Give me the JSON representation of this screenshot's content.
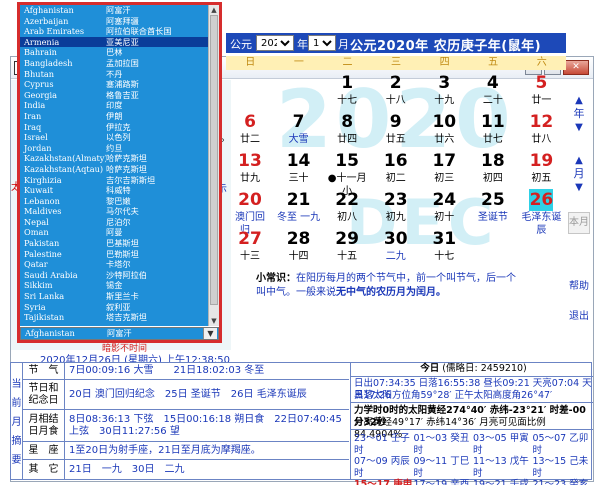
{
  "window": {
    "app_icon": "口",
    "buttons": [
      "▭",
      "▢",
      "✕"
    ]
  },
  "header": {
    "prefix": "公元",
    "year_value": "2020",
    "year_suffix": "年",
    "month_value": "12",
    "month_suffix": "月",
    "title": "公元2020年 农历庚子年(鼠年)"
  },
  "watermark": {
    "year": "2020",
    "month": "DEC"
  },
  "weekdays": [
    "日",
    "一",
    "二",
    "三",
    "四",
    "五",
    "六"
  ],
  "days": [
    {
      "d": "1",
      "l": "十七",
      "col": 2,
      "row": 0,
      "dc": "#000",
      "lc": "#000"
    },
    {
      "d": "2",
      "l": "十八",
      "col": 3,
      "row": 0,
      "dc": "#000",
      "lc": "#000"
    },
    {
      "d": "3",
      "l": "十九",
      "col": 4,
      "row": 0,
      "dc": "#000",
      "lc": "#000"
    },
    {
      "d": "4",
      "l": "二十",
      "col": 5,
      "row": 0,
      "dc": "#000",
      "lc": "#000"
    },
    {
      "d": "5",
      "l": "廿一",
      "col": 6,
      "row": 0,
      "dc": "#d42020",
      "lc": "#000"
    },
    {
      "d": "6",
      "l": "廿二",
      "col": 0,
      "row": 1,
      "dc": "#d42020",
      "lc": "#000"
    },
    {
      "d": "7",
      "l": "大雪",
      "col": 1,
      "row": 1,
      "dc": "#000",
      "lc": "#1a37b8"
    },
    {
      "d": "8",
      "l": "廿四",
      "col": 2,
      "row": 1,
      "dc": "#000",
      "lc": "#000"
    },
    {
      "d": "9",
      "l": "廿五",
      "col": 3,
      "row": 1,
      "dc": "#000",
      "lc": "#000"
    },
    {
      "d": "10",
      "l": "廿六",
      "col": 4,
      "row": 1,
      "dc": "#000",
      "lc": "#000"
    },
    {
      "d": "11",
      "l": "廿七",
      "col": 5,
      "row": 1,
      "dc": "#000",
      "lc": "#000"
    },
    {
      "d": "12",
      "l": "廿八",
      "col": 6,
      "row": 1,
      "dc": "#d42020",
      "lc": "#000"
    },
    {
      "d": "13",
      "l": "廿九",
      "col": 0,
      "row": 2,
      "dc": "#d42020",
      "lc": "#000"
    },
    {
      "d": "14",
      "l": "三十",
      "col": 1,
      "row": 2,
      "dc": "#000",
      "lc": "#000"
    },
    {
      "d": "15",
      "l": "●十一月小",
      "col": 2,
      "row": 2,
      "dc": "#000",
      "lc": "#000"
    },
    {
      "d": "16",
      "l": "初二",
      "col": 3,
      "row": 2,
      "dc": "#000",
      "lc": "#000"
    },
    {
      "d": "17",
      "l": "初三",
      "col": 4,
      "row": 2,
      "dc": "#000",
      "lc": "#000"
    },
    {
      "d": "18",
      "l": "初四",
      "col": 5,
      "row": 2,
      "dc": "#000",
      "lc": "#000"
    },
    {
      "d": "19",
      "l": "初五",
      "col": 6,
      "row": 2,
      "dc": "#d42020",
      "lc": "#000"
    },
    {
      "d": "20",
      "l": "澳门回归…",
      "col": 0,
      "row": 3,
      "dc": "#d42020",
      "lc": "#1a37b8"
    },
    {
      "d": "21",
      "l": "冬至 一九",
      "col": 1,
      "row": 3,
      "dc": "#000",
      "lc": "#1a37b8"
    },
    {
      "d": "22",
      "l": "初八",
      "col": 2,
      "row": 3,
      "dc": "#000",
      "lc": "#000"
    },
    {
      "d": "23",
      "l": "初九",
      "col": 3,
      "row": 3,
      "dc": "#000",
      "lc": "#000"
    },
    {
      "d": "24",
      "l": "初十",
      "col": 4,
      "row": 3,
      "dc": "#000",
      "lc": "#000"
    },
    {
      "d": "25",
      "l": "圣诞节",
      "col": 5,
      "row": 3,
      "dc": "#000",
      "lc": "#1a37b8"
    },
    {
      "d": "26",
      "l": "毛泽东诞辰",
      "col": 6,
      "row": 3,
      "dc": "#d42020",
      "lc": "#1a37b8",
      "today": true
    },
    {
      "d": "27",
      "l": "十三",
      "col": 0,
      "row": 4,
      "dc": "#d42020",
      "lc": "#000"
    },
    {
      "d": "28",
      "l": "十四",
      "col": 1,
      "row": 4,
      "dc": "#000",
      "lc": "#000"
    },
    {
      "d": "29",
      "l": "十五",
      "col": 2,
      "row": 4,
      "dc": "#000",
      "lc": "#000"
    },
    {
      "d": "30",
      "l": "二九",
      "col": 3,
      "row": 4,
      "dc": "#000",
      "lc": "#1a37b8"
    },
    {
      "d": "31",
      "l": "十七",
      "col": 4,
      "row": 4,
      "dc": "#000",
      "lc": "#000"
    }
  ],
  "side_buttons": {
    "year_up": "▲",
    "year_label": "年",
    "year_down": "▼",
    "month_up": "▲",
    "month_label": "月",
    "month_down": "▼",
    "this_month": "本月",
    "help": "帮助",
    "exit": "退出"
  },
  "tip": {
    "label": "小常识：",
    "text1": "在阳历每月的两个节气中，前一个叫节气，后一个",
    "text2a": "叫中气。一般来说",
    "text2b": "无中气的农历月为闰月。"
  },
  "left_pane": {
    "partial1": "时",
    "partial2": "25°",
    "partial3": "太",
    "partial4": "时示"
  },
  "bottom": {
    "partial_top": "暗影不时间",
    "datetime": "2020年12月26日 (星期六) 上午12:38:50",
    "vlabel": [
      "当",
      "前",
      "月",
      "摘",
      "要"
    ],
    "rows": [
      {
        "k": "节　气",
        "v": "7日00:09:16 大雪　　21日18:02:03 冬至"
      },
      {
        "k": "节日和\n纪念日",
        "v": "20日 澳门回归纪念　25日 圣诞节　26日 毛泽东诞辰"
      },
      {
        "k": "月相结\n日月食",
        "v": "8日08:36:13 下弦　15日00:16:18 朔日食　22日07:40:45 上弦　30日11:27:56 望"
      },
      {
        "k": "星　座",
        "v": "1至20日为射手座，21日至月底为摩羯座。"
      },
      {
        "k": "其　它",
        "v": "21日　一九　30日　二九"
      }
    ],
    "right": {
      "today_label": "今日",
      "today_value": "(儒略日: 2459210)",
      "line1": "日出07:34:35 日落16:55:38 昼长09:21 天亮07:04 天黑17:26",
      "line2": "日落太阳方位角59°28′ 正午太阳高度角26°47′",
      "line3": "力学时0时的太阳黄经274°40′ 赤纬-23°21′ 时差-00分32秒",
      "line4": "月亮黄经49°17′ 赤纬14°36′ 月亮可见面比例84.4904%",
      "hours": [
        "23～01 壬子时",
        "01～03 癸丑时",
        "03～05 甲寅时",
        "05～07 乙卯时",
        "07～09 丙辰时",
        "09～11 丁巳时",
        "11～13 戊午时",
        "13～15 己未时",
        "15～17 庚申时",
        "17～19 辛酉时",
        "19～21 壬戌时",
        "21～23 癸亥时"
      ],
      "current_hour_index": 8
    }
  },
  "country_dropdown": {
    "items": [
      {
        "en": "Afghanistan",
        "cn": "阿富汗"
      },
      {
        "en": "Azerbaijan",
        "cn": "阿塞拜疆"
      },
      {
        "en": "Arab Emirates",
        "cn": "阿拉伯联合酋长国"
      },
      {
        "en": "Armenia",
        "cn": "亚美尼亚"
      },
      {
        "en": "Bahrain",
        "cn": "巴林"
      },
      {
        "en": "Bangladesh",
        "cn": "孟加拉国"
      },
      {
        "en": "Bhutan",
        "cn": "不丹"
      },
      {
        "en": "Cyprus",
        "cn": "塞浦路斯"
      },
      {
        "en": "Georgia",
        "cn": "格鲁吉亚"
      },
      {
        "en": "India",
        "cn": "印度"
      },
      {
        "en": "Iran",
        "cn": "伊朗"
      },
      {
        "en": "Iraq",
        "cn": "伊拉克"
      },
      {
        "en": "Israel",
        "cn": "以色列"
      },
      {
        "en": "Jordan",
        "cn": "约旦"
      },
      {
        "en": "Kazakhstan(Almaty)",
        "cn": "哈萨克斯坦"
      },
      {
        "en": "Kazakhstan(Aqtau)",
        "cn": "哈萨克斯坦"
      },
      {
        "en": "Kirghizia",
        "cn": "吉尔吉斯斯坦"
      },
      {
        "en": "Kuwait",
        "cn": "科威特"
      },
      {
        "en": "Lebanon",
        "cn": "黎巴嫩"
      },
      {
        "en": "Maldives",
        "cn": "马尔代夫"
      },
      {
        "en": "Nepal",
        "cn": "尼泊尔"
      },
      {
        "en": "Oman",
        "cn": "阿曼"
      },
      {
        "en": "Pakistan",
        "cn": "巴基斯坦"
      },
      {
        "en": "Palestine",
        "cn": "巴勒斯坦"
      },
      {
        "en": "Qatar",
        "cn": "卡塔尔"
      },
      {
        "en": "Saudi Arabia",
        "cn": "沙特阿拉伯"
      },
      {
        "en": "Sikkim",
        "cn": "锡金"
      },
      {
        "en": "Sri Lanka",
        "cn": "斯里兰卡"
      },
      {
        "en": "Syria",
        "cn": "叙利亚"
      },
      {
        "en": "Tajikistan",
        "cn": "塔吉克斯坦"
      }
    ],
    "selected_index": 3,
    "selected_en": "Afghanistan",
    "selected_cn": "阿富汗",
    "combo_arrow": "▼"
  }
}
